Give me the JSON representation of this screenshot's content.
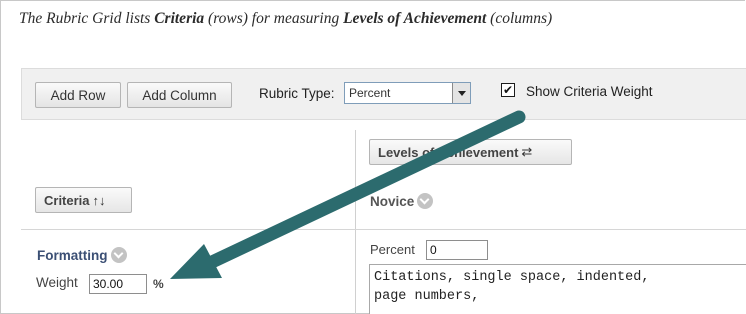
{
  "intro": {
    "p1": "The Rubric Grid lists ",
    "b1": "Criteria",
    "p2": " (rows) for measuring ",
    "b2": "Levels of Achievement",
    "p3": " (columns)"
  },
  "toolbar": {
    "add_row": "Add Row",
    "add_column": "Add Column",
    "rubric_type_label": "Rubric Type:",
    "rubric_type_value": "Percent",
    "show_weight_label": "Show Criteria Weight",
    "show_weight_checked": true,
    "check_mark": "✔"
  },
  "grid": {
    "levels_button": "Levels of Achievement",
    "levels_icon": "⇄",
    "criteria_button": "Criteria",
    "criteria_icon": "↑↓",
    "level_name": "Novice",
    "row_name": "Formatting",
    "weight_label": "Weight",
    "weight_value": "30.00",
    "weight_unit": "%",
    "percent_label": "Percent",
    "percent_value": "0",
    "description": "Citations, single space, indented,\npage numbers,"
  },
  "annotation": {
    "arrow_color": "#2c6b6e"
  }
}
